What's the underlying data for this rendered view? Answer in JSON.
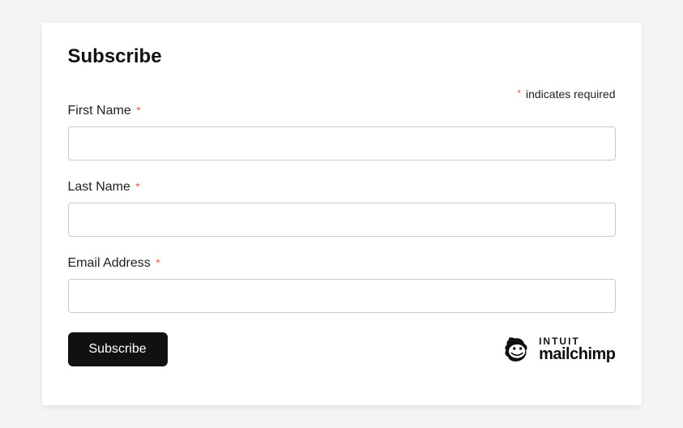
{
  "title": "Subscribe",
  "required_note": "indicates required",
  "asterisk": "*",
  "fields": {
    "first_name": {
      "label": "First Name",
      "value": ""
    },
    "last_name": {
      "label": "Last Name",
      "value": ""
    },
    "email": {
      "label": "Email Address",
      "value": ""
    }
  },
  "submit_label": "Subscribe",
  "brand": {
    "top": "INTUIT",
    "bottom": "mailchimp"
  }
}
